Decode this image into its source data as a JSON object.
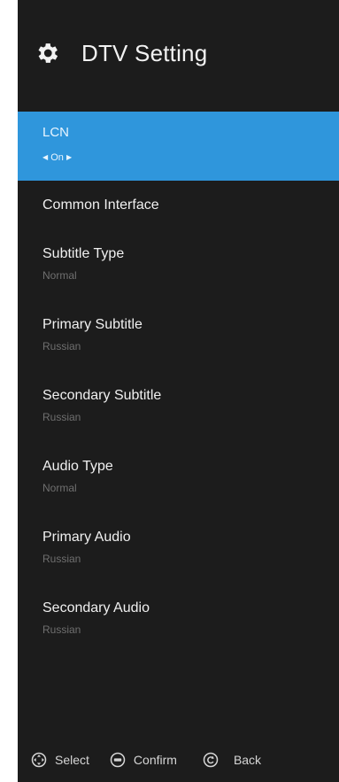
{
  "header": {
    "title": "DTV Setting",
    "icon": "gear-icon"
  },
  "menu": {
    "items": [
      {
        "label": "LCN",
        "value": "On",
        "selected": true
      },
      {
        "label": "Common Interface"
      },
      {
        "label": "Subtitle Type",
        "value": "Normal"
      },
      {
        "label": "Primary Subtitle",
        "value": "Russian"
      },
      {
        "label": "Secondary Subtitle",
        "value": "Russian"
      },
      {
        "label": "Audio Type",
        "value": "Normal"
      },
      {
        "label": "Primary Audio",
        "value": "Russian"
      },
      {
        "label": "Secondary Audio",
        "value": "Russian"
      }
    ]
  },
  "footer": {
    "select_label": "Select",
    "confirm_label": "Confirm",
    "back_label": "Back"
  },
  "colors": {
    "panel_bg": "#1c1c1c",
    "highlight": "#2f96dc"
  }
}
